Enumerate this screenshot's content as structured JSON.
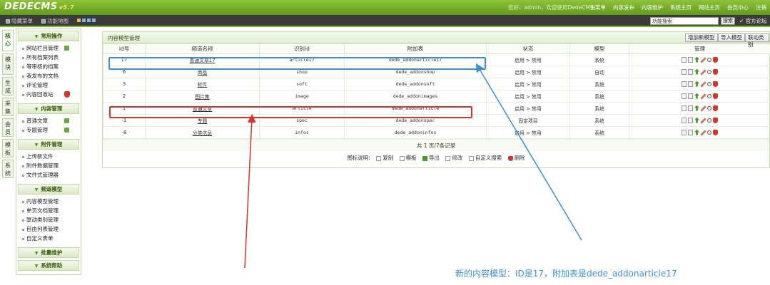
{
  "header": {
    "logo": "DEDECMS",
    "version": "v5.7",
    "welcome": "您好：admin，欢迎使用DedeCMS！",
    "nav": [
      "主菜单",
      "内容发布",
      "内容维护",
      "系统主页",
      "网站主页",
      "会员中心",
      "注销"
    ]
  },
  "subbar": {
    "hide_menu": "隐藏菜单",
    "func_map": "功能地图",
    "search_value": "功能搜索",
    "search_button": "搜索",
    "forum": "官方论坛"
  },
  "vtabs": [
    "核心",
    "模块",
    "生成",
    "采集",
    "会员",
    "模板",
    "系统"
  ],
  "sidebar": {
    "sections": [
      {
        "title": "常用操作",
        "items": [
          "网站栏目管理",
          "所有档案列表",
          "等审核的档案",
          "我发布的文档",
          "评论管理",
          "内容回收站"
        ]
      },
      {
        "title": "内容管理",
        "items": [
          "普通文章",
          "专题管理"
        ]
      },
      {
        "title": "附件管理",
        "items": [
          "上传新文件",
          "附件数据管理",
          "文件式管理器"
        ]
      },
      {
        "title": "频道模型",
        "items": [
          "内容模型管理",
          "单页文档管理",
          "联动类别管理",
          "自由列表管理",
          "自定义表单"
        ]
      },
      {
        "title": "批量维护",
        "items": []
      },
      {
        "title": "系统帮助",
        "items": []
      }
    ]
  },
  "main": {
    "title": "内容模型管理",
    "buttons": [
      "增加新模型",
      "导入模型",
      "联动类别"
    ],
    "columns": [
      "id号",
      "频道名称",
      "识别id",
      "附加表",
      "状态",
      "模型",
      "管理"
    ],
    "rows": [
      {
        "id": "17",
        "name": "普通文章17",
        "nid": "article17",
        "table": "dede_addonarticle17",
        "status": "启用 > 禁用",
        "model": "系统"
      },
      {
        "id": "6",
        "name": "商品",
        "nid": "shop",
        "table": "dede_addonshop",
        "status": "启用 > 禁用",
        "model": "自动"
      },
      {
        "id": "3",
        "name": "软件",
        "nid": "soft",
        "table": "dede_addonsoft",
        "status": "启用 > 禁用",
        "model": "系统"
      },
      {
        "id": "2",
        "name": "图片集",
        "nid": "image",
        "table": "dede_addonimages",
        "status": "启用 > 禁用",
        "model": "系统"
      },
      {
        "id": "1",
        "name": "普通文章",
        "nid": "article",
        "table": "dede_addonarticle",
        "status": "启用 > 禁用",
        "model": "系统"
      },
      {
        "id": "-1",
        "name": "专题",
        "nid": "spec",
        "table": "dede_addonspec",
        "status": "固定项目",
        "model": "系统"
      },
      {
        "id": "-8",
        "name": "分类信息",
        "nid": "infos",
        "table": "dede_addoninfos",
        "status": "启用 > 禁用",
        "model": "系统"
      }
    ],
    "footer": "共 1 页/7条记录",
    "legend": {
      "label": "图标说明:",
      "items": [
        "复制",
        "模板",
        "导出",
        "修改",
        "自定义搜索",
        "删除"
      ]
    }
  },
  "annotation": {
    "note": "新的内容模型：ID是17，附加表是dede_addonarticle17",
    "blue": "#3a8fd8",
    "red": "#d8332b"
  }
}
